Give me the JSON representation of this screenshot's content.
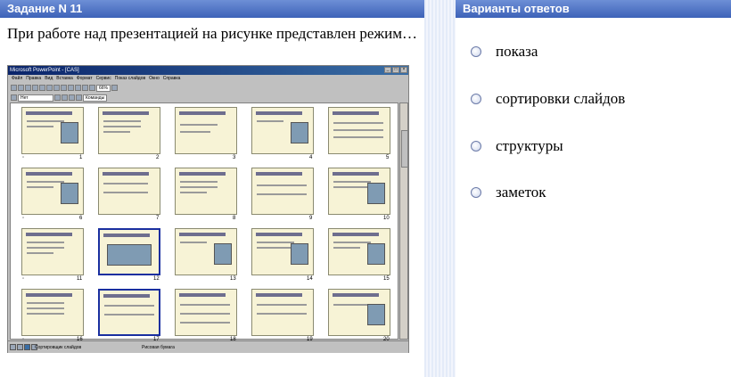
{
  "header": {
    "task_title": "Задание N 11",
    "answers_title": "Варианты ответов"
  },
  "question": {
    "text": "При работе над презентацией на рисунке представлен режим…"
  },
  "ppt": {
    "title": "Microsoft PowerPoint - [CAS]",
    "menu": [
      "Файл",
      "Правка",
      "Вид",
      "Вставка",
      "Формат",
      "Сервис",
      "Показ слайдов",
      "Окно",
      "Справка"
    ],
    "zoom": "66%",
    "font_box": "Нет",
    "commands": "Команды",
    "status_mode": "Сортировщик слайдов",
    "status_template": "Рисовая бумага",
    "slide_numbers": [
      "1",
      "2",
      "3",
      "4",
      "5",
      "6",
      "7",
      "8",
      "9",
      "10",
      "11",
      "12",
      "13",
      "14",
      "15",
      "16",
      "17",
      "18",
      "19",
      "20"
    ]
  },
  "answers": [
    {
      "label": "показа"
    },
    {
      "label": "сортировки слайдов"
    },
    {
      "label": "структуры"
    },
    {
      "label": "заметок"
    }
  ]
}
